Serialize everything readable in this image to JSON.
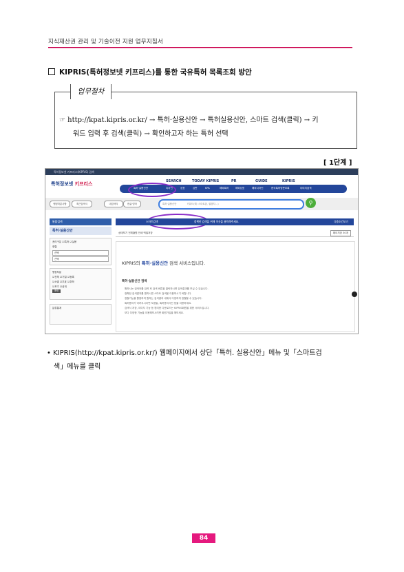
{
  "header": {
    "title": "지식재산권 관리 및 기술이전 지원 업무지침서"
  },
  "section": {
    "title": "KIPRIS(특허정보넷 키프리스)를 통한 국유특허 목록조회 방안"
  },
  "procedure": {
    "tag": "업무절차",
    "line1": "☞ http://kpat.kipris.or.kr/ → 특허·실용신안 → 특허실용신안, 스마트 검색(클릭) → 키",
    "line2": "워드 입력 후 검색(클릭) → 확인하고자 하는 특허 선택"
  },
  "step_label": "[ 1단계 ]",
  "screenshot": {
    "browser_title": "특허정보넷 키프리스(KIPRIS) 검색",
    "logo_main": "특허정보넷",
    "logo_brand": "키프리스",
    "topnav": [
      "SEARCH",
      "TODAY KIPRIS",
      "PR",
      "GUIDE",
      "KIPRIS"
    ],
    "menu": [
      "특허·실용신안",
      "디자인",
      "상표",
      "심판",
      "KPA",
      "해외특허",
      "해외상표",
      "해외디자인",
      "한국특허영문초록",
      "이미지검색"
    ],
    "pills": [
      "행정처분사항",
      "최근검색식",
      "내검색식",
      "한글·영어"
    ],
    "search_scope": "특허·실용신안",
    "search_placeholder": "키워드(예: 스마트폰, 발명자...)",
    "sidebar_head": "통합검색",
    "sidebar_sub": "특허·실용신안",
    "sidebar_lines": [
      "권리구분",
      "특허",
      "실용"
    ],
    "sidebar_sort": "정렬",
    "sidebar_select1": "선택",
    "sidebar_select2": "선택",
    "sidebar_status": "행정처분",
    "sidebar_status_items": [
      "전체",
      "거절",
      "등록",
      "소멸",
      "무효",
      "취하",
      "포기",
      "공개"
    ],
    "sidebar_btn": "확인",
    "sidebar_class": "분류통계",
    "bluebar_left": "스마트검색",
    "bluebar_mid": "정확한 검색을 위해 이곳을 클릭해주세요.",
    "bluebar_right": "다중조건보기",
    "toolbar_text": "상태보기   전체출원   인쇄   엑셀저장",
    "toolbar_right": "페이지당 30개",
    "panel_title_brand": "KIPRIS의",
    "panel_title_bold": "특허·실용신안",
    "panel_title_rest": "검색 서비스입니다.",
    "guide_head": "특허·실용신안 검색",
    "guide_lines": [
      "원하시는 검색어를 입력 후 검색 버튼을 클릭하시면 검색결과를 보실 수 있습니다.",
      "정확한 검색결과를 원하시면 스마트 검색을 이용하시기 바랍니다.",
      "정렬기능을 활용하여 원하는 검색결과 내에서 다양하게 정렬할 수 있습니다.",
      "특허용어가 어려우시다면 도움말, 특허용어사전 등을 이용하세요.",
      "검색식 저장, 이미지 기능 등 편리한 다운로드는 KIPRIS회원을 위한 서비스입니다.",
      "보다 다양한 기능을 이용해보시려면 회원가입을 해보세요."
    ]
  },
  "bullet": {
    "line1": "• KIPRIS(http://kpat.kipris.or.kr/) 웹페이지에서 상단「특허. 실용신안」메뉴 및「스마트검",
    "line2": "색」메뉴를 클릭"
  },
  "page_number": "84",
  "colors": {
    "accent": "#d0195e",
    "page_badge": "#e5197e",
    "kipris_blue": "#23469a",
    "highlight_oval": "#8a2cc8"
  }
}
